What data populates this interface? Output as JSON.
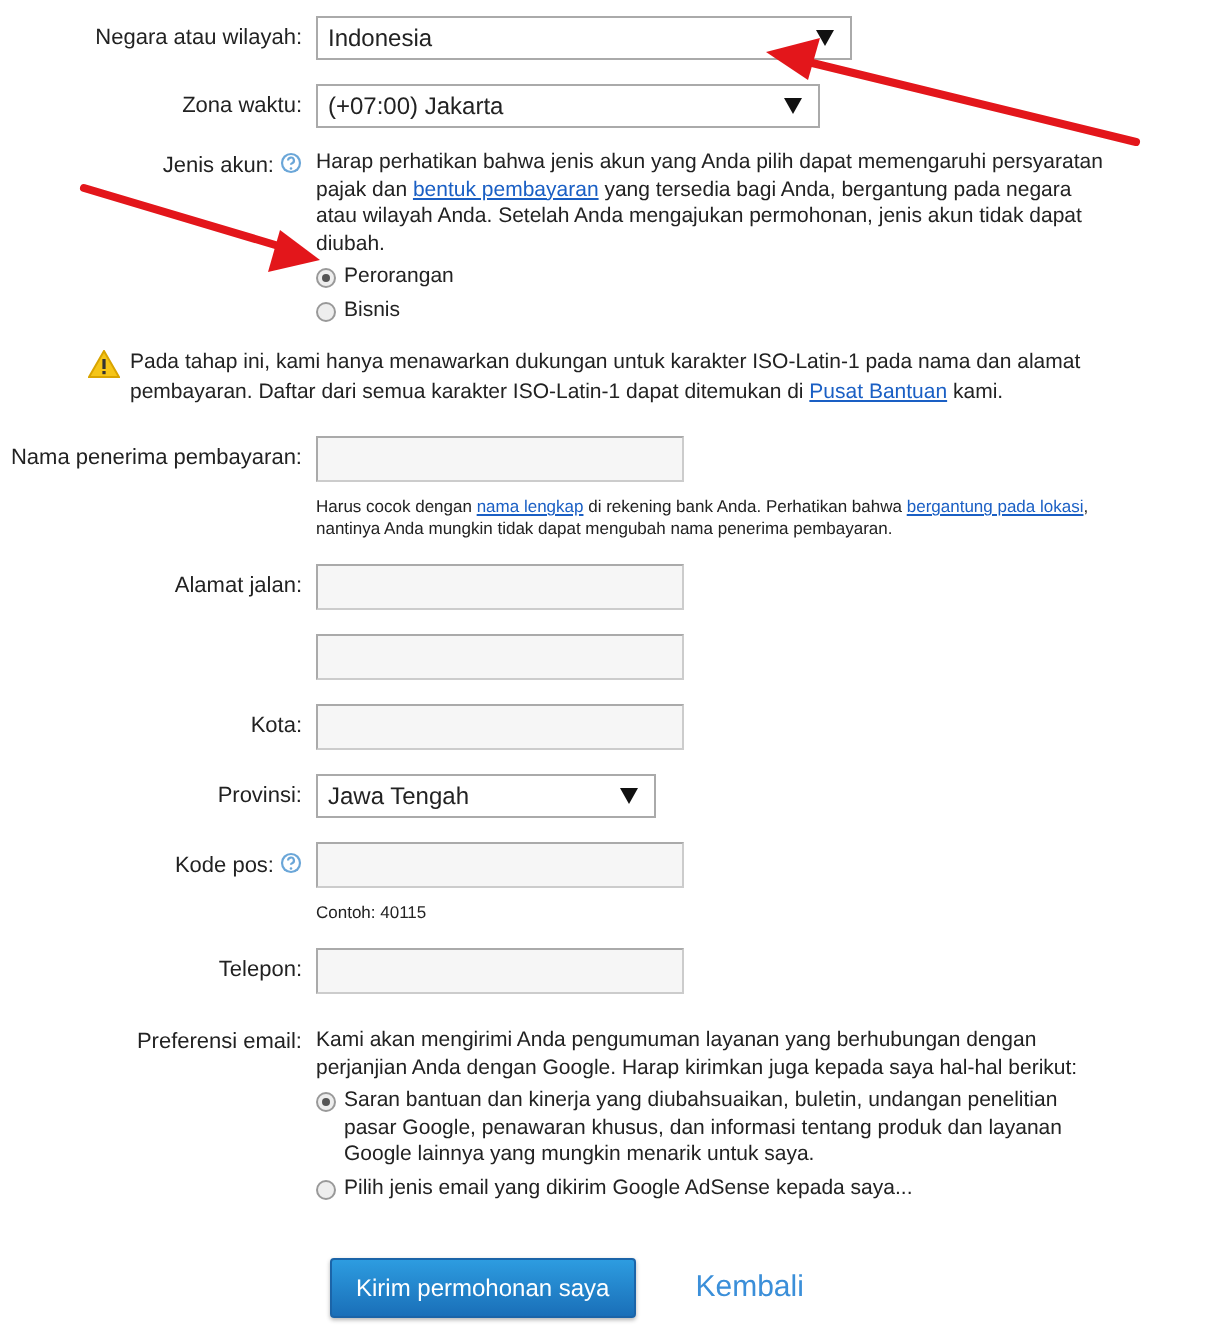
{
  "rows": [
    {
      "kind": "select",
      "label": "Negara atau wilayah:",
      "value": "Indonesia"
    },
    {
      "kind": "select",
      "label": "Zona waktu:",
      "value": "(+07:00) Jakarta"
    },
    {
      "kind": "choice",
      "label": "Jenis akun:",
      "help": true,
      "text": [
        {
          "text": "Harap perhatikan bahwa jenis akun yang Anda pilih dapat memengaruhi persyaratan pajak dan ",
          "link": false
        },
        {
          "text": "bentuk pembayaran",
          "link": true
        },
        {
          "text": " yang tersedia bagi Anda, bergantung pada negara atau wilayah Anda. Setelah Anda mengajukan permohonan, jenis akun tidak dapat diubah.",
          "link": false
        }
      ],
      "options": [
        {
          "label": "Perorangan",
          "selected": true
        },
        {
          "label": "Bisnis",
          "selected": false
        }
      ]
    },
    {
      "kind": "notice",
      "text": [
        {
          "text": "Pada tahap ini, kami hanya menawarkan dukungan untuk karakter ISO-Latin-1 pada nama dan alamat pembayaran. Daftar dari semua karakter ISO-Latin-1 dapat ditemukan di ",
          "link": false
        },
        {
          "text": "Pusat Bantuan",
          "link": true
        },
        {
          "text": " kami.",
          "link": false
        }
      ]
    },
    {
      "kind": "input",
      "label": "Nama penerima pembayaran:",
      "hint": [
        {
          "text": "Harus cocok dengan ",
          "link": false
        },
        {
          "text": "nama lengkap",
          "link": true
        },
        {
          "text": " di rekening bank Anda. Perhatikan bahwa ",
          "link": false
        },
        {
          "text": "bergantung pada lokasi",
          "link": true
        },
        {
          "text": ", nantinya Anda mungkin tidak dapat mengubah nama penerima pembayaran.",
          "link": false
        }
      ]
    },
    {
      "kind": "input",
      "label": "Alamat jalan:"
    },
    {
      "kind": "input"
    },
    {
      "kind": "input",
      "label": "Kota:"
    },
    {
      "kind": "select",
      "label": "Provinsi:",
      "value": "Jawa Tengah"
    },
    {
      "kind": "input",
      "label": "Kode pos:",
      "help": true,
      "hint": [
        {
          "text": "Contoh: 40115",
          "link": false
        }
      ]
    },
    {
      "kind": "input",
      "label": "Telepon:"
    },
    {
      "kind": "choice",
      "label": "Preferensi email:",
      "text": [
        {
          "text": "Kami akan mengirimi Anda pengumuman layanan yang berhubungan dengan perjanjian Anda dengan Google. Harap kirimkan juga kepada saya hal-hal berikut:",
          "link": false
        }
      ],
      "options": [
        {
          "label": "Saran bantuan dan kinerja yang diubahsuaikan, buletin, undangan penelitian pasar Google, penawaran khusus, dan informasi tentang produk dan layanan Google lainnya yang mungkin menarik untuk saya.",
          "selected": true
        },
        {
          "label": "Pilih jenis email yang dikirim Google AdSense kepada saya...",
          "selected": false
        }
      ]
    }
  ],
  "actions": {
    "submit": "Kirim permohonan saya",
    "back": "Kembali"
  }
}
